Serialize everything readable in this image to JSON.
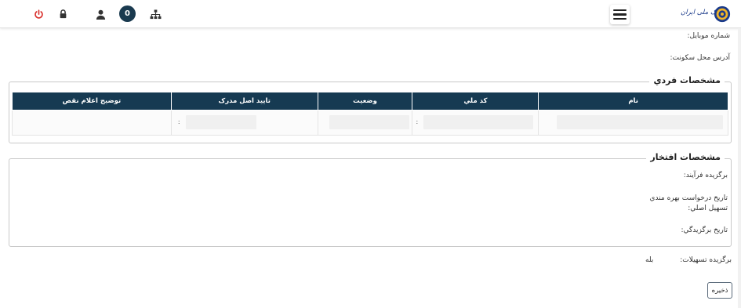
{
  "header": {
    "badge_count": "0",
    "icons": [
      "power-icon",
      "lock-icon",
      "user-icon",
      "sitemap-icon",
      "menu-icon"
    ],
    "logo_text": "بانک ملی ایران",
    "accent_color": "#163a52",
    "power_color": "#d9302c"
  },
  "contact": {
    "mobile_label": "شماره موبایل:",
    "address_label": "آدرس محل سکونت:"
  },
  "personal": {
    "title": "مشخصات فردي",
    "columns": [
      "نام",
      "کد ملي",
      "وضعيت",
      "تاييد اصل مدرک",
      "توضيح اعلام نقص"
    ],
    "row_colon": ":"
  },
  "honor": {
    "title": "مشخصات افتخار",
    "process_label": "برگزيده فرآيند:",
    "request_date_label": "تاريخ درخواست بهره مندي",
    "loan_label": "تسهيل اصلي:",
    "selection_date_label": "تاريخ برگزيدگي:"
  },
  "facility": {
    "label": "برگزيده تسهيلات:",
    "value": "بله"
  },
  "actions": {
    "save_label": "ذخيره"
  }
}
